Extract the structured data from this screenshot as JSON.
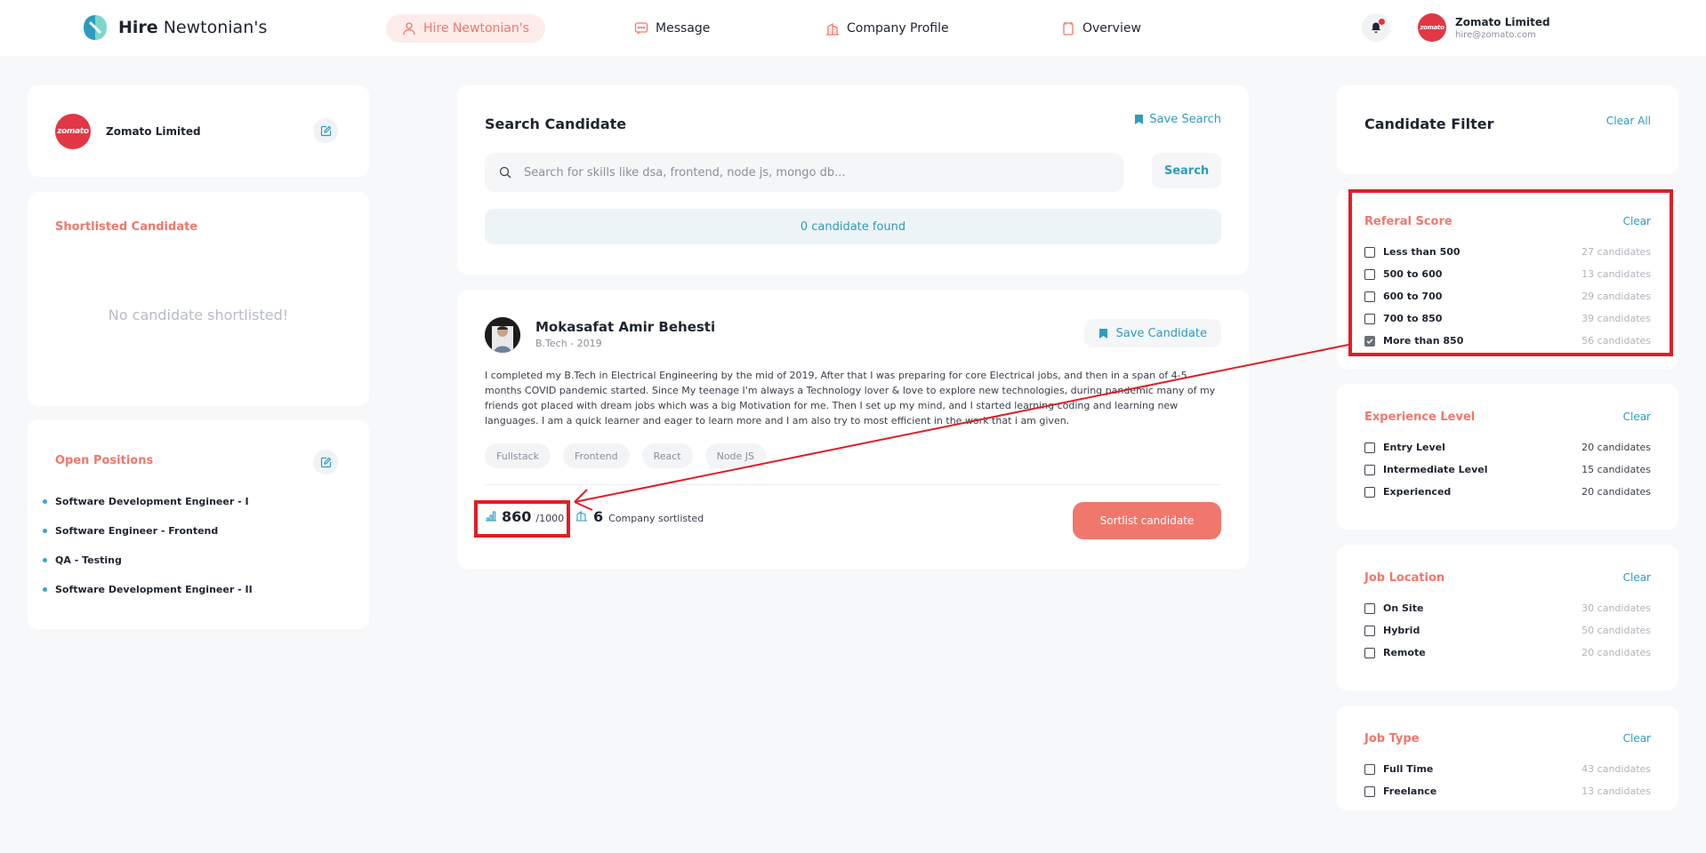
{
  "brand": {
    "bold": "Hire",
    "rest": " Newtonian's"
  },
  "nav": {
    "items": [
      {
        "label": "Hire Newtonian's",
        "active": true
      },
      {
        "label": "Message",
        "active": false
      },
      {
        "label": "Company Profile",
        "active": false
      },
      {
        "label": "Overview",
        "active": false
      }
    ]
  },
  "user": {
    "avatar_text": "zomato",
    "name": "Zomato Limited",
    "email": "hire@zomato.com"
  },
  "company": {
    "avatar_text": "zomato",
    "name": "Zomato Limited"
  },
  "shortlist": {
    "title": "Shortlisted Candidate",
    "empty": "No candidate shortlisted!"
  },
  "positions": {
    "title": "Open Positions",
    "items": [
      "Software Development Engineer - I",
      "Software Engineer - Frontend",
      "QA - Testing",
      "Software Development Engineer - II"
    ]
  },
  "search": {
    "title": "Search Candidate",
    "save_label": "Save Search",
    "placeholder": "Search for skills like dsa, frontend, node js, mongo db...",
    "button": "Search",
    "found": "0 candidate found"
  },
  "candidate": {
    "name": "Mokasafat Amir Behesti",
    "education": "B.Tech - 2019",
    "save_label": "Save Candidate",
    "bio": "I completed my B.Tech in Electrical Engineering by the mid of 2019, After that I was preparing for core Electrical jobs, and then in a span of 4-5 months COVID pandemic started. Since My teenage I'm always a Technology lover & love to explore new technologies, during pandemic many of my friends got placed with dream jobs which was a big Motivation for me. Then I set up my mind, and I started learning coding and learning new languages. I am a quick learner and eager to learn more and I am also try to most efficient in the work that i am given.",
    "tags": [
      "Fullstack",
      "Frontend",
      "React",
      "Node JS"
    ],
    "score": "860",
    "score_max": "/1000",
    "companies": "6",
    "companies_label": "Company sortlisted",
    "sortlist_label": "Sortlist candidate"
  },
  "filter": {
    "title": "Candidate Filter",
    "clear_all": "Clear All",
    "clear": "Clear",
    "referal": {
      "title": "Referal Score",
      "options": [
        {
          "label": "Less than 500",
          "count": "27 candidates",
          "checked": false
        },
        {
          "label": "500 to 600",
          "count": "13 candidates",
          "checked": false
        },
        {
          "label": "600 to 700",
          "count": "29 candidates",
          "checked": false
        },
        {
          "label": "700 to 850",
          "count": "39 candidates",
          "checked": false
        },
        {
          "label": "More than 850",
          "count": "56 candidates",
          "checked": true
        }
      ]
    },
    "experience": {
      "title": "Experience Level",
      "options": [
        {
          "label": "Entry Level",
          "count": "20 candidates",
          "checked": false
        },
        {
          "label": "Intermediate Level",
          "count": "15 candidates",
          "checked": false
        },
        {
          "label": "Experienced",
          "count": "20 candidates",
          "checked": false
        }
      ]
    },
    "location": {
      "title": "Job Location",
      "options": [
        {
          "label": "On Site",
          "count": "30 candidates",
          "checked": false
        },
        {
          "label": "Hybrid",
          "count": "50 candidates",
          "checked": false
        },
        {
          "label": "Remote",
          "count": "20 candidates",
          "checked": false
        }
      ]
    },
    "type": {
      "title": "Job Type",
      "options": [
        {
          "label": "Full Time",
          "count": "43 candidates",
          "checked": false
        },
        {
          "label": "Freelance",
          "count": "13 candidates",
          "checked": false
        }
      ]
    }
  },
  "colors": {
    "accent": "#f0776b",
    "link": "#2c9bbf",
    "zomato": "#e23744",
    "highlight": "#e01e26"
  }
}
